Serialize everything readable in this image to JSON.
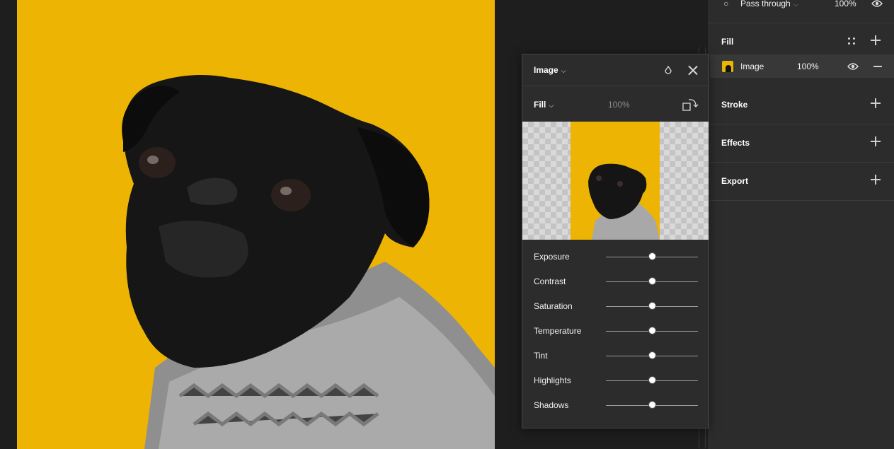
{
  "colors": {
    "canvas_bg": "#1e1e1e",
    "panel_bg": "#2c2c2c",
    "image_yellow": "#edb404",
    "selection_blue": "#2f8ad6"
  },
  "canvas": {
    "image_description_icon": "pug-photo"
  },
  "layer": {
    "icon": "blend-drop-icon",
    "mode": "Pass through",
    "opacity": "100%"
  },
  "sections": {
    "fill": {
      "title": "Fill"
    },
    "stroke": {
      "title": "Stroke"
    },
    "effects": {
      "title": "Effects"
    },
    "export": {
      "title": "Export"
    }
  },
  "fill_item": {
    "type": "Image",
    "opacity": "100%"
  },
  "dialog": {
    "title": "Image",
    "fill_mode": "Fill",
    "fill_opacity": "100%",
    "adjustments": [
      {
        "label": "Exposure",
        "value": 0.5
      },
      {
        "label": "Contrast",
        "value": 0.5
      },
      {
        "label": "Saturation",
        "value": 0.5
      },
      {
        "label": "Temperature",
        "value": 0.5
      },
      {
        "label": "Tint",
        "value": 0.5
      },
      {
        "label": "Highlights",
        "value": 0.5
      },
      {
        "label": "Shadows",
        "value": 0.5
      }
    ]
  }
}
